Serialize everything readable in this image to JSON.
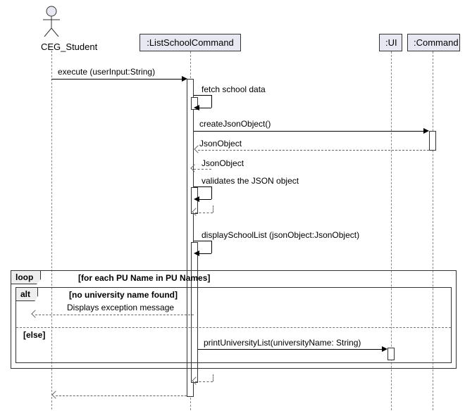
{
  "actor": {
    "name": "CEG_Student"
  },
  "participants": {
    "listSchool": {
      "label": ":ListSchoolCommand"
    },
    "ui": {
      "label": ":UI"
    },
    "command": {
      "label": ":Command"
    }
  },
  "messages": {
    "m1": "execute (userInput:String)",
    "m2": "fetch school data",
    "m3": "createJsonObject()",
    "m4": "JsonObject",
    "m5": "JsonObject",
    "m6": "validates the JSON object",
    "m7": "displaySchoolList (jsonObject:JsonObject)",
    "m8": "Displays exception message",
    "m9": "printUniversityList(universityName: String)"
  },
  "fragments": {
    "loop": {
      "label": "loop",
      "guard": "[for each PU Name in PU Names]"
    },
    "alt": {
      "label": "alt",
      "guard1": "[no university name found]",
      "guard2": "[else]"
    }
  },
  "chart_data": {
    "type": "sequence_diagram",
    "participants": [
      {
        "name": "CEG_Student",
        "kind": "actor"
      },
      {
        "name": ":ListSchoolCommand",
        "kind": "object"
      },
      {
        "name": ":UI",
        "kind": "object"
      },
      {
        "name": ":Command",
        "kind": "object"
      }
    ],
    "interactions": [
      {
        "from": "CEG_Student",
        "to": ":ListSchoolCommand",
        "label": "execute (userInput:String)",
        "type": "sync"
      },
      {
        "from": ":ListSchoolCommand",
        "to": ":ListSchoolCommand",
        "label": "fetch school data",
        "type": "self"
      },
      {
        "from": ":ListSchoolCommand",
        "to": ":Command",
        "label": "createJsonObject()",
        "type": "sync"
      },
      {
        "from": ":Command",
        "to": ":ListSchoolCommand",
        "label": "JsonObject",
        "type": "return"
      },
      {
        "from": ":ListSchoolCommand",
        "to": ":ListSchoolCommand",
        "label": "JsonObject",
        "type": "self-return"
      },
      {
        "from": ":ListSchoolCommand",
        "to": ":ListSchoolCommand",
        "label": "validates the JSON object",
        "type": "self"
      },
      {
        "from": ":ListSchoolCommand",
        "to": ":ListSchoolCommand",
        "label": "displaySchoolList (jsonObject:JsonObject)",
        "type": "self"
      },
      {
        "fragment": "loop",
        "guard": "[for each PU Name in PU Names]",
        "contents": [
          {
            "fragment": "alt",
            "cases": [
              {
                "guard": "[no university name found]",
                "contents": [
                  {
                    "from": ":ListSchoolCommand",
                    "to": "CEG_Student",
                    "label": "Displays exception message",
                    "type": "return"
                  }
                ]
              },
              {
                "guard": "[else]",
                "contents": [
                  {
                    "from": ":ListSchoolCommand",
                    "to": ":UI",
                    "label": "printUniversityList(universityName: String)",
                    "type": "sync"
                  }
                ]
              }
            ]
          }
        ]
      },
      {
        "from": ":ListSchoolCommand",
        "to": ":ListSchoolCommand",
        "label": "",
        "type": "self-return"
      },
      {
        "from": ":ListSchoolCommand",
        "to": "CEG_Student",
        "label": "",
        "type": "return"
      }
    ]
  }
}
